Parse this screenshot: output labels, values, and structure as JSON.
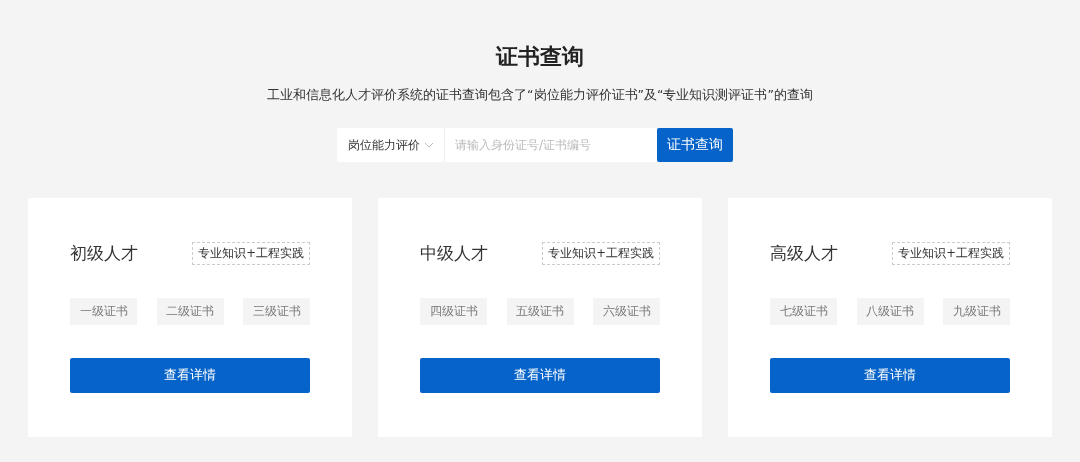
{
  "header": {
    "title": "证书查询",
    "subtitle": "工业和信息化人才评价系统的证书查询包含了“岗位能力评价证书”及“专业知识测评证书”的查询"
  },
  "search": {
    "dropdown": "岗位能力评价",
    "placeholder": "请输入身份证号/证书编号",
    "button": "证书查询"
  },
  "cards": [
    {
      "title": "初级人才",
      "tag": "专业知识+工程实践",
      "certificates": [
        "一级证书",
        "二级证书",
        "三级证书"
      ],
      "button": "查看详情"
    },
    {
      "title": "中级人才",
      "tag": "专业知识+工程实践",
      "certificates": [
        "四级证书",
        "五级证书",
        "六级证书"
      ],
      "button": "查看详情"
    },
    {
      "title": "高级人才",
      "tag": "专业知识+工程实践",
      "certificates": [
        "七级证书",
        "八级证书",
        "九级证书"
      ],
      "button": "查看详情"
    }
  ]
}
